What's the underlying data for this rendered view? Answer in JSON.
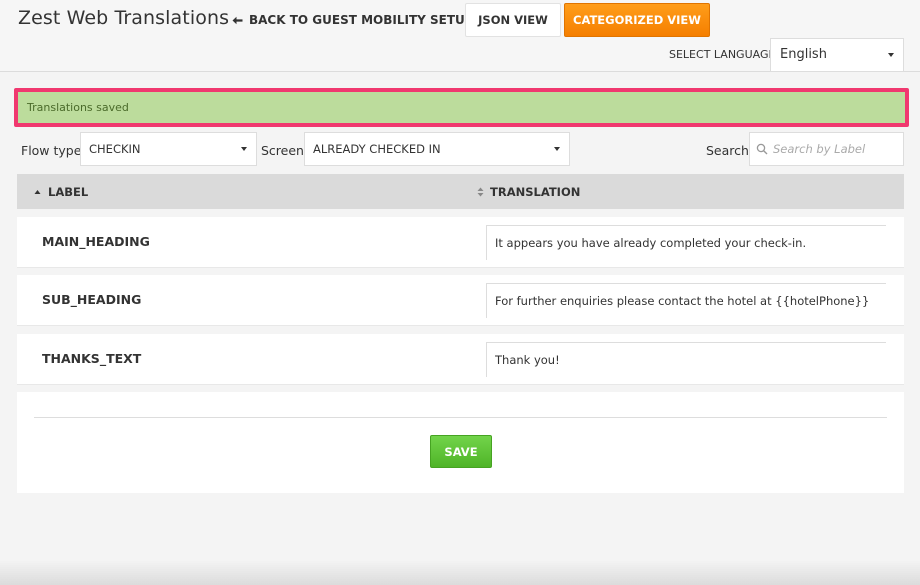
{
  "header": {
    "title": "Zest Web Translations",
    "back_label": "BACK TO GUEST MOBILITY SETUP",
    "json_view_label": "JSON VIEW",
    "categorized_view_label": "CATEGORIZED VIEW",
    "language_label": "SELECT LANGUAGE",
    "language_value": "English"
  },
  "alert": {
    "message": "Translations saved"
  },
  "filters": {
    "flow_type_label": "Flow type",
    "flow_type_value": "CHECKIN",
    "screen_label": "Screen",
    "screen_value": "ALREADY CHECKED IN",
    "search_label": "Search",
    "search_placeholder": "Search by Label"
  },
  "table": {
    "col_label": "LABEL",
    "col_translation": "TRANSLATION",
    "rows": [
      {
        "label": "MAIN_HEADING",
        "translation": "It appears you have already completed your check-in."
      },
      {
        "label": "SUB_HEADING",
        "translation": "For further enquiries please contact the hotel at {{hotelPhone}}"
      },
      {
        "label": "THANKS_TEXT",
        "translation": "Thank you!"
      }
    ]
  },
  "footer": {
    "save_label": "SAVE"
  },
  "colors": {
    "accent_orange": "#f57f00",
    "save_green": "#5cc232",
    "alert_bg": "#bcdc9c",
    "alert_border": "#f0386f"
  }
}
